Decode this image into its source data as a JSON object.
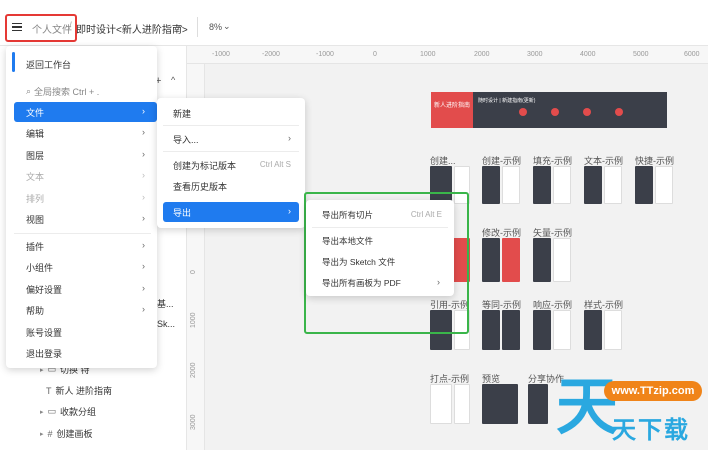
{
  "topbar": {
    "crumb_personal": "个人文件",
    "crumb_sep": "/",
    "crumb_project": "即时设计<新人进阶指南>",
    "zoom": "8%"
  },
  "ruler": {
    "top_ticks": [
      "-1000",
      "-2000",
      "-1000",
      "0",
      "1000",
      "2000",
      "3000",
      "4000",
      "5000",
      "6000"
    ],
    "left_ticks": [
      "0",
      "1000",
      "2000",
      "3000"
    ]
  },
  "main_menu": {
    "back": "返回工作台",
    "search_placeholder": "全局搜索 Ctrl + .",
    "items": [
      {
        "label": "文件",
        "has_sub": true,
        "active": true,
        "disabled": false
      },
      {
        "label": "编辑",
        "has_sub": true,
        "active": false,
        "disabled": false
      },
      {
        "label": "图层",
        "has_sub": true,
        "active": false,
        "disabled": false
      },
      {
        "label": "文本",
        "has_sub": true,
        "active": false,
        "disabled": true
      },
      {
        "label": "排列",
        "has_sub": true,
        "active": false,
        "disabled": true
      },
      {
        "label": "视图",
        "has_sub": true,
        "active": false,
        "disabled": false
      },
      {
        "label": "插件",
        "has_sub": true,
        "active": false,
        "disabled": false
      },
      {
        "label": "小组件",
        "has_sub": true,
        "active": false,
        "disabled": false
      },
      {
        "label": "偏好设置",
        "has_sub": true,
        "active": false,
        "disabled": false
      },
      {
        "label": "帮助",
        "has_sub": true,
        "active": false,
        "disabled": false
      },
      {
        "label": "账号设置",
        "has_sub": false,
        "active": false,
        "disabled": false
      },
      {
        "label": "退出登录",
        "has_sub": false,
        "active": false,
        "disabled": false
      }
    ]
  },
  "file_menu": {
    "new": "新建",
    "import": "导入...",
    "create_version": "创建为标记版本",
    "create_version_shortcut": "Ctrl Alt S",
    "view_history": "查看历史版本",
    "export": "导出"
  },
  "export_menu": {
    "export_slices": "导出所有切片",
    "export_slices_shortcut": "Ctrl Alt E",
    "export_local": "导出本地文件",
    "export_sketch": "导出为 Sketch 文件",
    "export_pdf": "导出所有画板为 PDF"
  },
  "layers": {
    "cut1": "基...",
    "cut2": "Sk...",
    "rows": [
      {
        "label": "切换 特"
      },
      {
        "label": "新人 进阶指南"
      },
      {
        "label": "收款分组"
      },
      {
        "label": "创建画板"
      }
    ]
  },
  "canvas_labels": {
    "banner_red": "新人进阶指南",
    "banner_dark": "随时设计 | 新建指南(更新)",
    "row1": [
      "创建...",
      "创建-示例",
      "填充-示例",
      "文本-示例",
      "快捷-示例"
    ],
    "row2": [
      "修改-示例",
      "矢量-示例"
    ],
    "row3": [
      "引用-示例",
      "等同-示例",
      "响应-示例",
      "样式-示例"
    ],
    "row4": [
      "打点-示例",
      "预览",
      "分享协作"
    ]
  },
  "watermark": {
    "glyph": "天",
    "url": "www.TTzip.com",
    "cn": "天下载"
  },
  "colors": {
    "accent": "#1f7bef",
    "highlight_red": "#e53935",
    "highlight_green": "#3ab54a",
    "board_dark": "#3b3f49",
    "board_red": "#e24c4c"
  }
}
